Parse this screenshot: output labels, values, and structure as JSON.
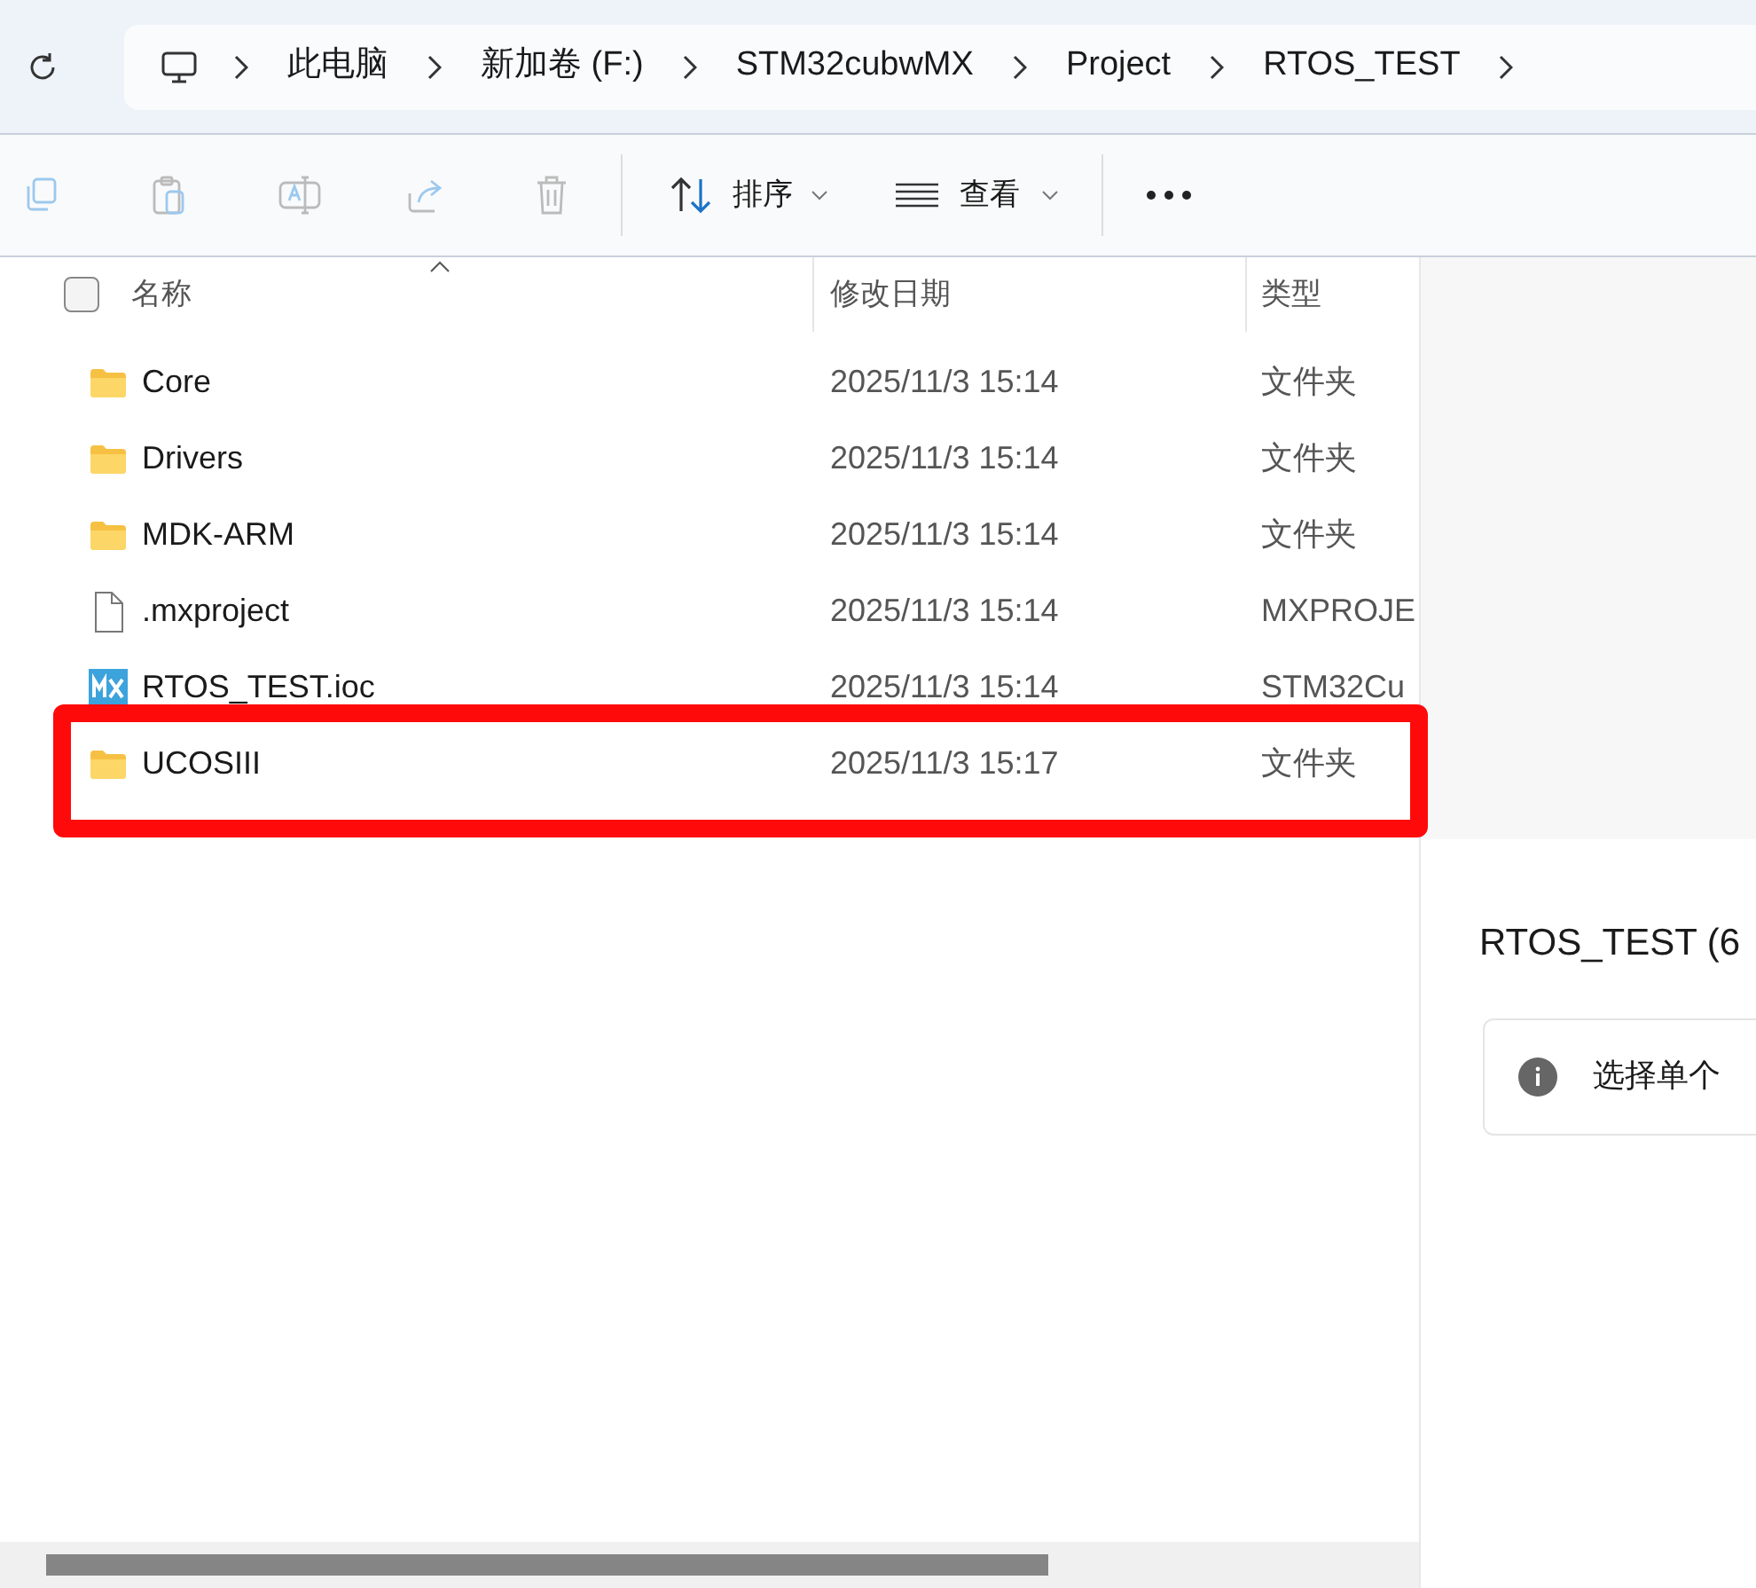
{
  "breadcrumb": [
    "此电脑",
    "新加卷 (F:)",
    "STM32cubwMX",
    "Project",
    "RTOS_TEST"
  ],
  "toolbar": {
    "sort": "排序",
    "view": "查看"
  },
  "select_all": {
    "checked": false
  },
  "columns": [
    "名称",
    "修改日期",
    "类型"
  ],
  "rows": [
    {
      "kind": "folder",
      "name": "Core",
      "date": "2025/11/3 15:14",
      "type": "文件夹",
      "highlighted": false
    },
    {
      "kind": "folder",
      "name": "Drivers",
      "date": "2025/11/3 15:14",
      "type": "文件夹",
      "highlighted": false
    },
    {
      "kind": "folder",
      "name": "MDK-ARM",
      "date": "2025/11/3 15:14",
      "type": "文件夹",
      "highlighted": false
    },
    {
      "kind": "file",
      "name": ".mxproject",
      "date": "2025/11/3 15:14",
      "type": "MXPROJE",
      "highlighted": false
    },
    {
      "kind": "mx",
      "name": "RTOS_TEST.ioc",
      "date": "2025/11/3 15:14",
      "type": "STM32Cu",
      "highlighted": false
    },
    {
      "kind": "folder",
      "name": "UCOSIII",
      "date": "2025/11/3 15:17",
      "type": "文件夹",
      "highlighted": true
    }
  ],
  "details": {
    "title": "RTOS_TEST (6",
    "info": "选择单个"
  }
}
